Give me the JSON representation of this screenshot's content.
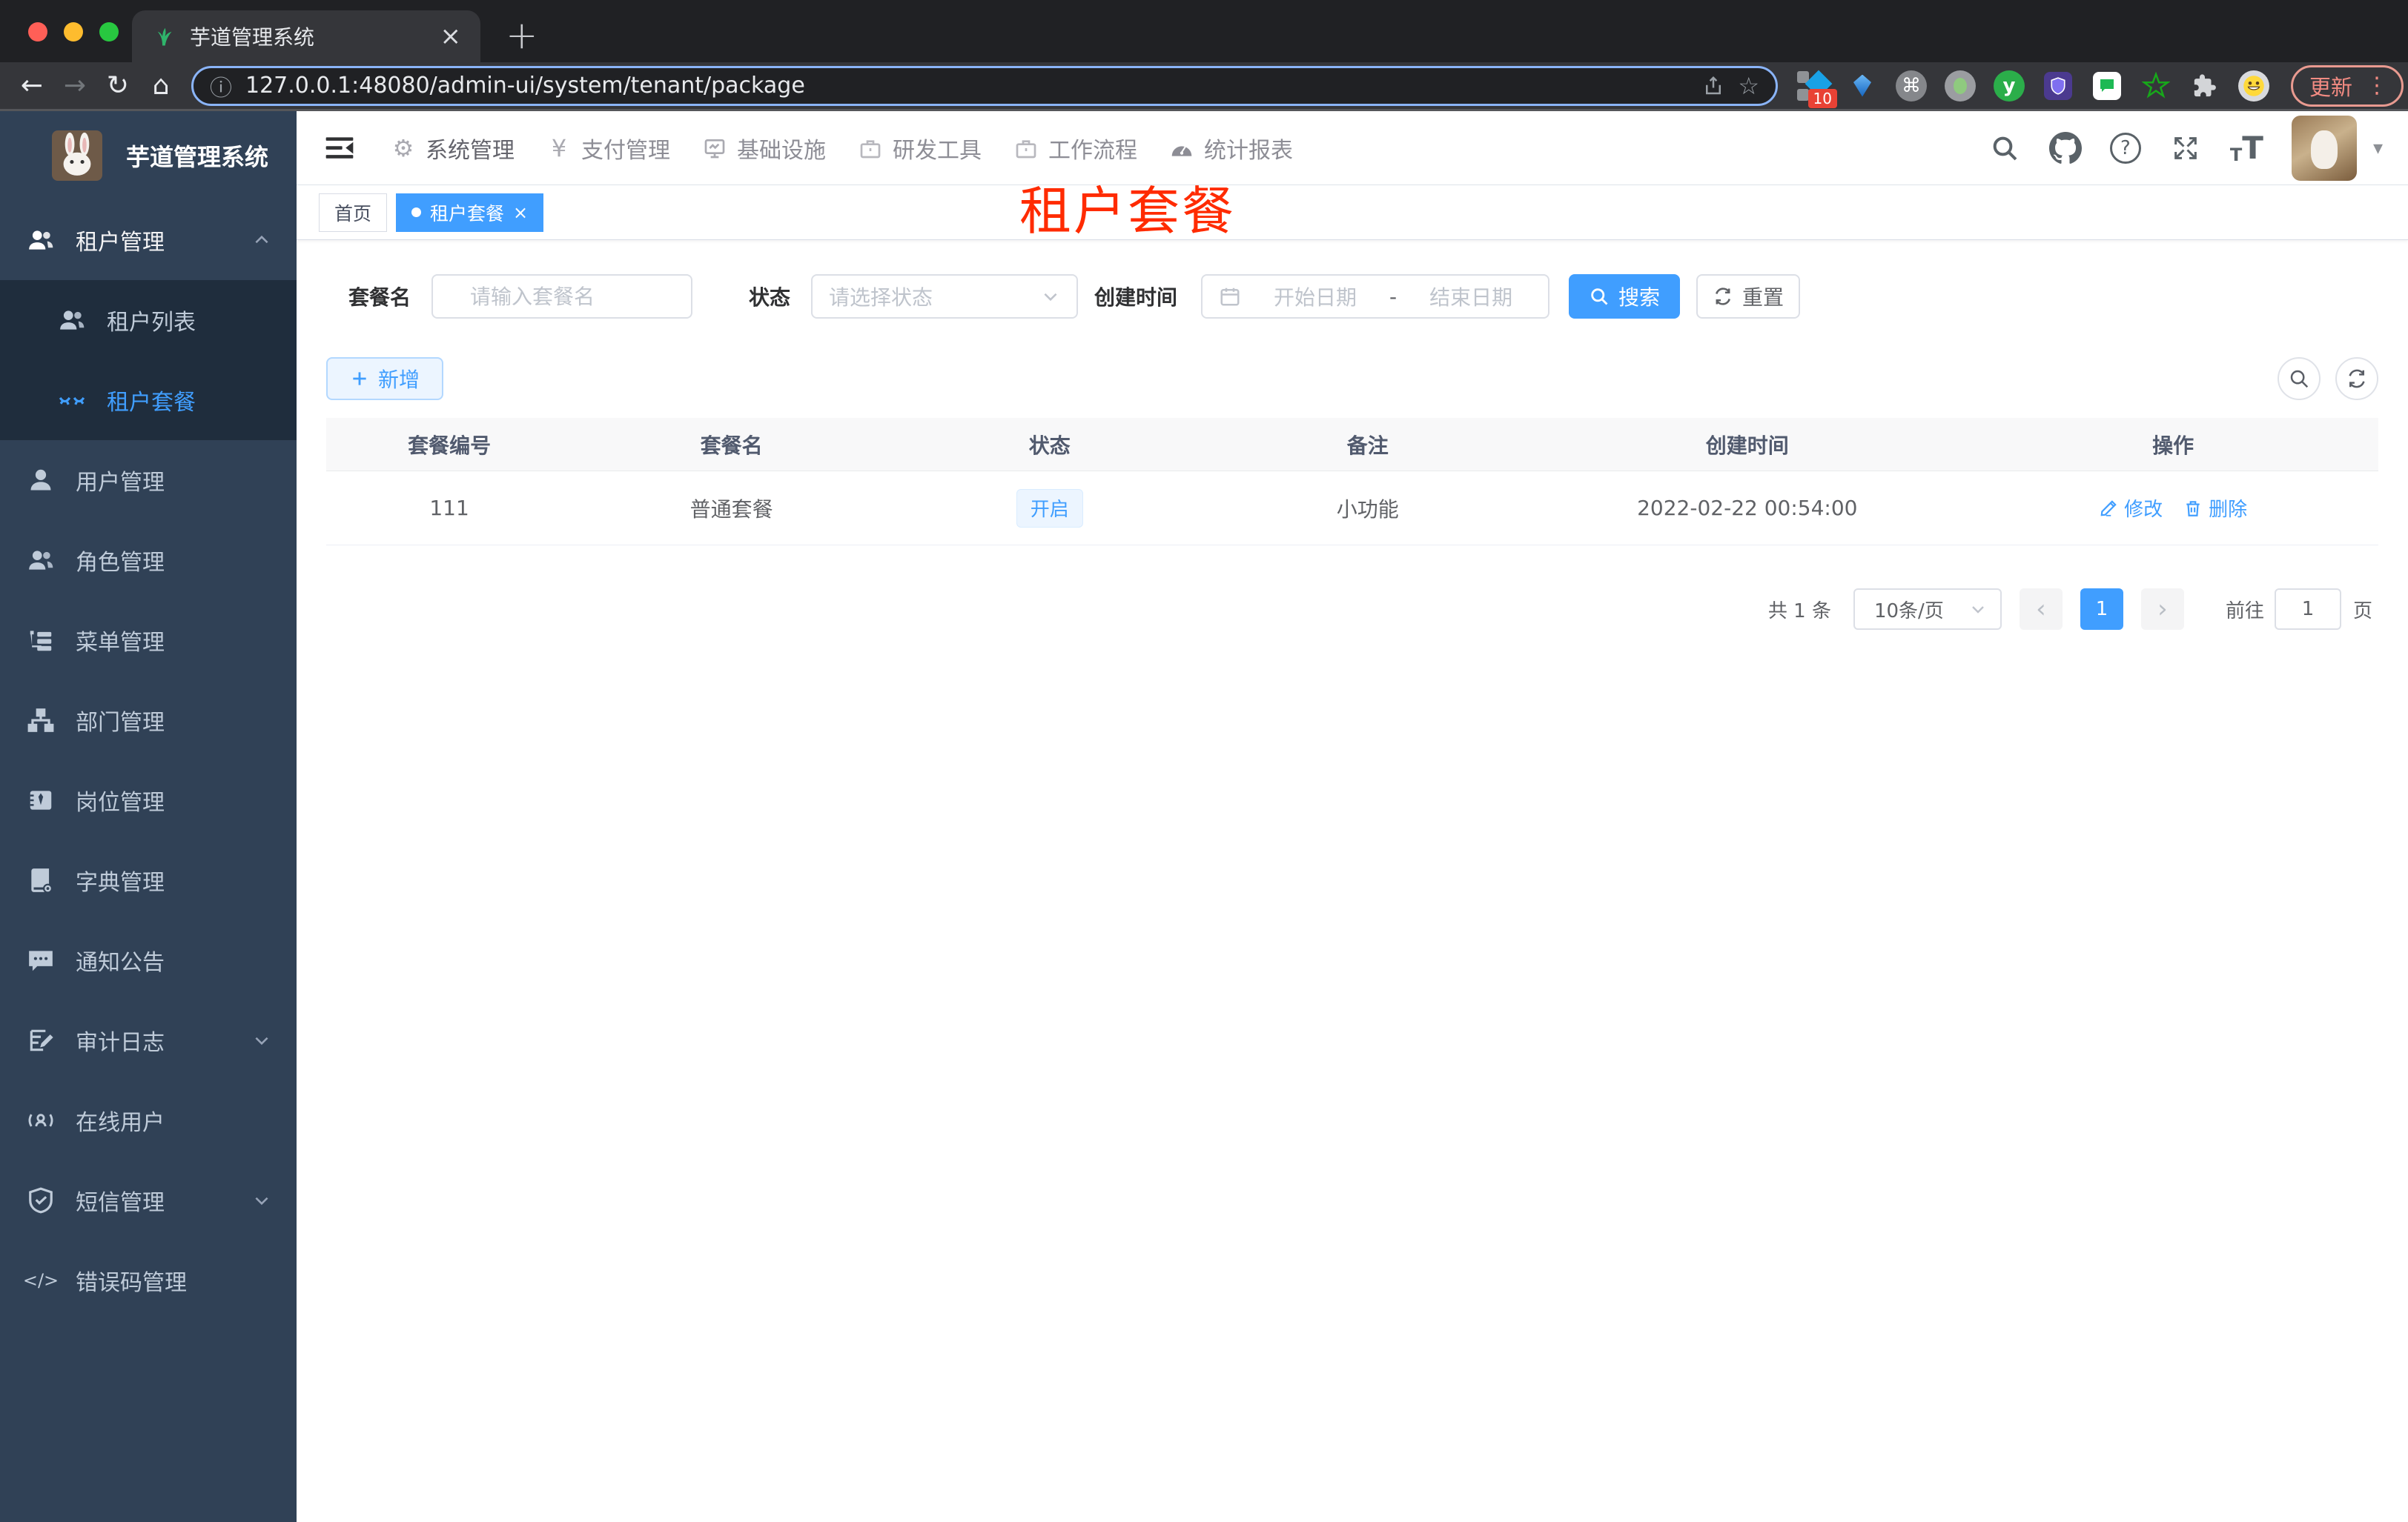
{
  "colors": {
    "accent": "#409eff",
    "overlay_red": "#ff2b00",
    "sidebar_bg": "#304156",
    "submenu_bg": "#1f2d3d",
    "status_tag_bg": "#ecf5ff",
    "chrome_dark": "#202124",
    "chrome_toolbar": "#35363a"
  },
  "icons": {
    "close": "×",
    "newtab": "+",
    "back": "←",
    "forward": "→",
    "reload": "↻",
    "home": "⌂",
    "info": "ⓘ",
    "star": "☆",
    "command": "⌘",
    "dots": "⋮",
    "help": "?",
    "caret": "▾",
    "prev": "‹",
    "next": "›",
    "gear": "⚙",
    "yen": "¥",
    "code": "</>",
    "y_logo": "y",
    "small_t": "T",
    "big_t": "T"
  },
  "browser": {
    "tab_title": "芋道管理系统",
    "url": "127.0.0.1:48080/admin-ui/system/tenant/package",
    "update_label": "更新",
    "extension_badge": "10"
  },
  "sidebar": {
    "app_title": "芋道管理系统",
    "items": [
      "租户管理",
      "租户列表",
      "租户套餐",
      "用户管理",
      "角色管理",
      "菜单管理",
      "部门管理",
      "岗位管理",
      "字典管理",
      "通知公告",
      "审计日志",
      "在线用户",
      "短信管理",
      "错误码管理"
    ]
  },
  "topnav": {
    "items": [
      "系统管理",
      "支付管理",
      "基础设施",
      "研发工具",
      "工作流程",
      "统计报表"
    ]
  },
  "tags": {
    "home": "首页",
    "active": "租户套餐"
  },
  "overlay": {
    "title": "租户套餐"
  },
  "search": {
    "name_label": "套餐名",
    "name_placeholder": "请输入套餐名",
    "status_label": "状态",
    "status_placeholder": "请选择状态",
    "date_label": "创建时间",
    "date_start": "开始日期",
    "date_separator": "-",
    "date_end": "结束日期",
    "search_button": "搜索",
    "reset_button": "重置"
  },
  "actions": {
    "add_button": "新增"
  },
  "table": {
    "columns": [
      "套餐编号",
      "套餐名",
      "状态",
      "备注",
      "创建时间",
      "操作"
    ],
    "rows": [
      {
        "id": "111",
        "name": "普通套餐",
        "status": "开启",
        "remark": "小功能",
        "created_at": "2022-02-22 00:54:00",
        "edit": "修改",
        "delete": "删除"
      }
    ]
  },
  "pagination": {
    "total": "共 1 条",
    "page_size": "10条/页",
    "current_page": "1",
    "goto_label": "前往",
    "goto_value": "1",
    "page_unit": "页"
  }
}
